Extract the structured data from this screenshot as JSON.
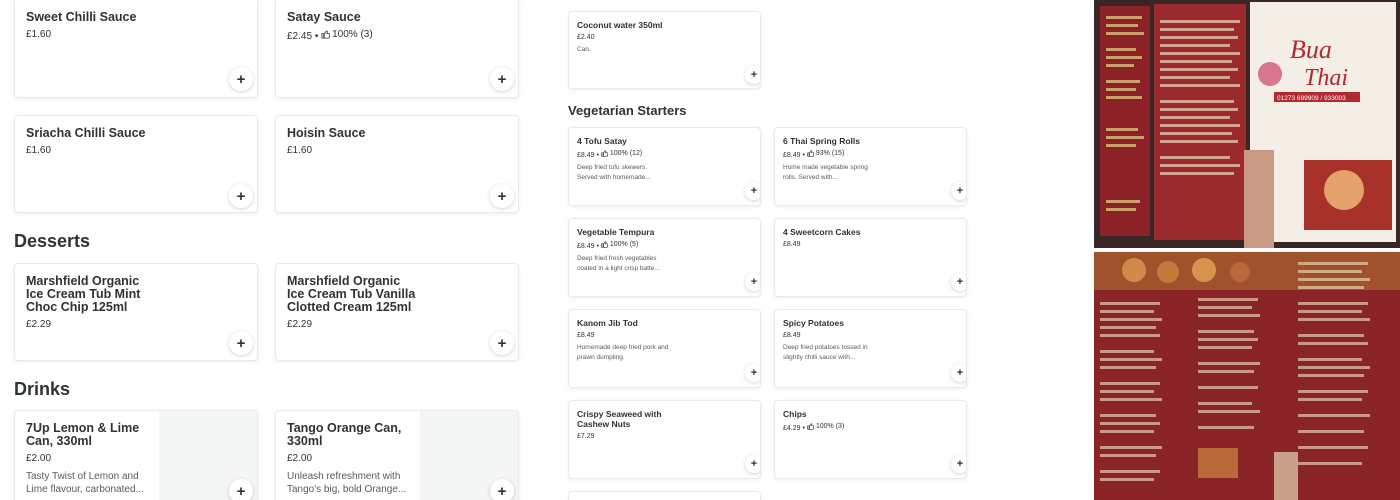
{
  "colA": {
    "items_top": [
      {
        "name": "Sweet Chilli Sauce",
        "price": "£1.60"
      },
      {
        "name": "Satay Sauce",
        "price": "£2.45",
        "rating": "100% (3)"
      },
      {
        "name": "Sriacha Chilli Sauce",
        "price": "£1.60"
      },
      {
        "name": "Hoisin Sauce",
        "price": "£1.60"
      }
    ],
    "desserts_title": "Desserts",
    "desserts": [
      {
        "name": "Marshfield Organic Ice Cream Tub Mint Choc Chip 125ml",
        "price": "£2.29"
      },
      {
        "name": "Marshfield Organic Ice Cream Tub Vanilla Clotted Cream 125ml",
        "price": "£2.29"
      }
    ],
    "drinks_title": "Drinks",
    "drinks": [
      {
        "name": "7Up Lemon & Lime Can, 330ml",
        "price": "£2.00",
        "desc": "Tasty Twist of Lemon and Lime flavour, carbonated..."
      },
      {
        "name": "Tango Orange Can, 330ml",
        "price": "£2.00",
        "desc": "Unleash refreshment with Tango's big, bold Orange..."
      }
    ]
  },
  "colB": {
    "top_item": {
      "name": "Coconut water 350ml",
      "price": "£2.40",
      "desc": "Can."
    },
    "veg_title": "Vegetarian Starters",
    "veg": [
      {
        "name": "4 Tofu Satay",
        "price": "£8.49",
        "rating": "100% (12)",
        "desc": "Deep fried tofu skewers. Served with homemade..."
      },
      {
        "name": "6 Thai Spring Rolls",
        "price": "£8.49",
        "rating": "93% (15)",
        "desc": "Home made vegetable spring rolls. Served with..."
      },
      {
        "name": "Vegetable Tempura",
        "price": "£8.49",
        "rating": "100% (5)",
        "desc": "Deep fried fresh vegetables coated in a light crisp batte..."
      },
      {
        "name": "4 Sweetcorn Cakes",
        "price": "£8.49"
      },
      {
        "name": "Kanom Jib Tod",
        "price": "£8.49",
        "desc": "Homemade deep fried pork and prawn dumpling."
      },
      {
        "name": "Spicy Potatoes",
        "price": "£8.49",
        "desc": "Deep fried potatoes tossed in slightly chilli sauce with..."
      },
      {
        "name": "Crispy Seaweed with Cashew Nuts",
        "price": "£7.29"
      },
      {
        "name": "Chips",
        "price": "£4.29",
        "rating": "100% (3)"
      }
    ]
  },
  "add_symbol": "+",
  "colors": {
    "text": "#2e3333",
    "border": "#e8ebeb",
    "menu_red": "#7b1f22"
  },
  "menu_photo": {
    "logo_text": "Bua Thai",
    "phone": "01273 699909 / 933003"
  }
}
